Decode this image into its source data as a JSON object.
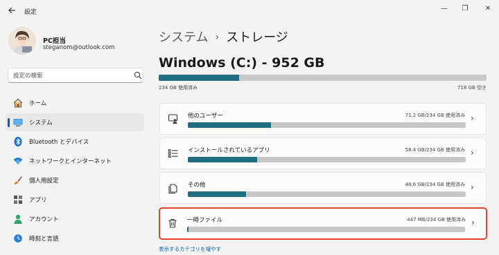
{
  "window": {
    "title": "設定",
    "back_icon": "back-arrow-icon",
    "minimize_glyph": "—",
    "maximize_glyph": "❐",
    "close_glyph": "✕"
  },
  "profile": {
    "name": "PC担当",
    "email": "steganom@outlook.com"
  },
  "search": {
    "placeholder": "設定の検索"
  },
  "sidebar": {
    "items": [
      {
        "label": "ホーム",
        "icon": "home-icon",
        "active": false
      },
      {
        "label": "システム",
        "icon": "system-monitor-icon",
        "active": true
      },
      {
        "label": "Bluetooth とデバイス",
        "icon": "bluetooth-icon",
        "active": false
      },
      {
        "label": "ネットワークとインターネット",
        "icon": "wifi-icon",
        "active": false
      },
      {
        "label": "個人用設定",
        "icon": "brush-icon",
        "active": false
      },
      {
        "label": "アプリ",
        "icon": "apps-icon",
        "active": false
      },
      {
        "label": "アカウント",
        "icon": "account-icon",
        "active": false
      },
      {
        "label": "時刻と言語",
        "icon": "globe-clock-icon",
        "active": false
      }
    ]
  },
  "breadcrumb": {
    "parent": "システム",
    "separator": "›",
    "current": "ストレージ"
  },
  "drive": {
    "title": "Windows (C:) - 952 GB",
    "used_label": "234 GB 使用済み",
    "free_label": "718 GB 空き",
    "used_fraction": 0.246
  },
  "categories": [
    {
      "label": "他のユーザー",
      "usage": "71.2 GB/234 GB 使用済み",
      "fraction": 0.3,
      "icon": "other-users-icon",
      "highlighted": false
    },
    {
      "label": "インストールされているアプリ",
      "usage": "58.4 GB/234 GB 使用済み",
      "fraction": 0.25,
      "icon": "installed-apps-icon",
      "highlighted": false
    },
    {
      "label": "その他",
      "usage": "48.6 GB/234 GB 使用済み",
      "fraction": 0.21,
      "icon": "other-files-icon",
      "highlighted": false
    },
    {
      "label": "一時ファイル",
      "usage": "447 MB/234 GB 使用済み",
      "fraction": 0.005,
      "icon": "trash-icon",
      "highlighted": true
    }
  ],
  "more_link": "表示するカテゴリを増やす",
  "colors": {
    "accent": "#005fb8",
    "bar_fill": "#1e6d80",
    "bar_track": "#c7c7c7",
    "highlight_border": "#e0452a"
  }
}
